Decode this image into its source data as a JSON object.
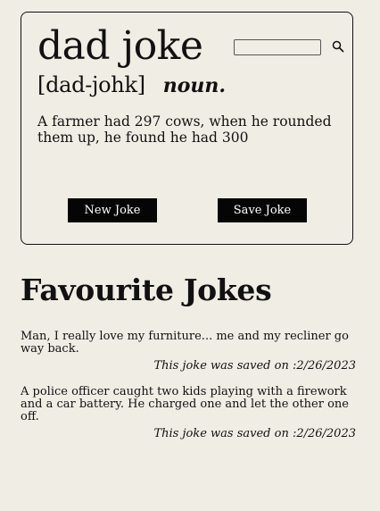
{
  "card": {
    "word": "dad joke",
    "pronunciation": "[dad-johk]",
    "part_of_speech": "noun.",
    "joke": "A farmer had 297 cows, when he rounded them up, he found he had 300",
    "search": {
      "value": "",
      "icon": "search-icon"
    },
    "buttons": {
      "new_label": "New Joke",
      "save_label": "Save Joke"
    }
  },
  "favourites": {
    "heading": "Favourite Jokes",
    "date_prefix": "This joke was saved on :",
    "items": [
      {
        "text": "Man, I really love my furniture... me and my recliner go way back.",
        "date": "2/26/2023"
      },
      {
        "text": "A police officer caught two kids playing with a firework and a car battery. He charged one and let the other one off.",
        "date": "2/26/2023"
      }
    ]
  },
  "colors": {
    "background": "#efede4",
    "text": "#111111",
    "button_bg": "#050505",
    "button_text": "#ffffff"
  }
}
